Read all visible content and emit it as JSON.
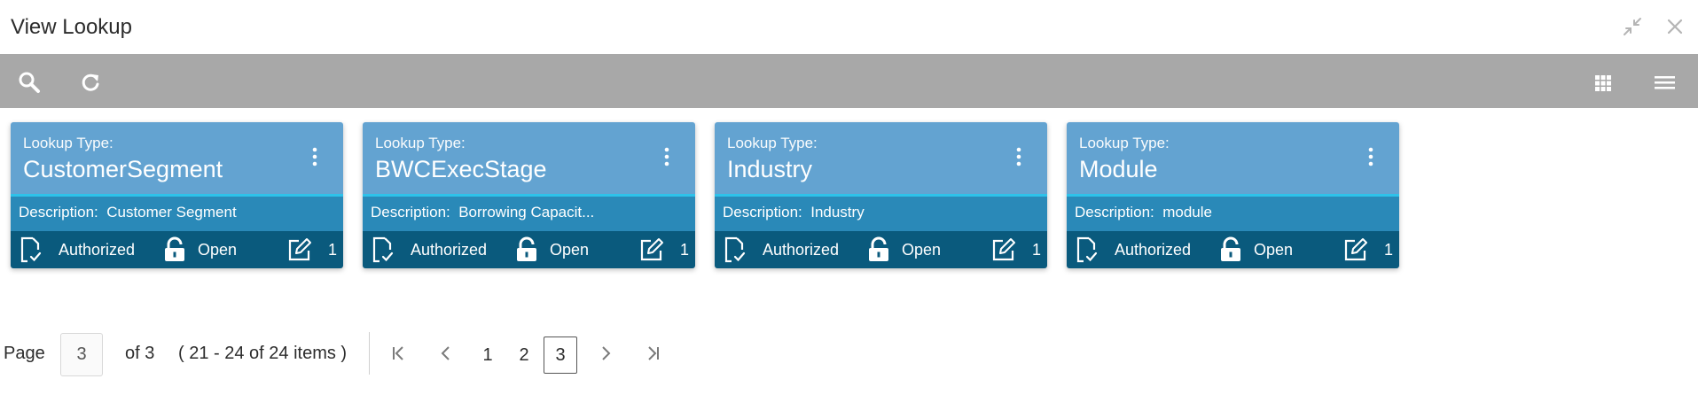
{
  "window": {
    "title": "View Lookup",
    "icons": [
      "minimize-icon",
      "close-icon"
    ]
  },
  "toolbar": {
    "left_icons": [
      "search-icon",
      "refresh-icon"
    ],
    "right_icons": [
      "grid-view-icon",
      "list-view-icon"
    ]
  },
  "colors": {
    "card_header": "#63a3d1",
    "card_accent": "#2ec2ea",
    "card_description": "#2a89b8",
    "card_footer": "#0a5a7d",
    "toolbar": "#a8a8a8"
  },
  "cards": [
    {
      "type_label": "Lookup Type:",
      "type_value": "CustomerSegment",
      "description_label": "Description:",
      "description_value": "Customer Segment",
      "status": "Authorized",
      "lock_state": "Open",
      "version": "1"
    },
    {
      "type_label": "Lookup Type:",
      "type_value": "BWCExecStage",
      "description_label": "Description:",
      "description_value": "Borrowing Capacit...",
      "status": "Authorized",
      "lock_state": "Open",
      "version": "1"
    },
    {
      "type_label": "Lookup Type:",
      "type_value": "Industry",
      "description_label": "Description:",
      "description_value": "Industry",
      "status": "Authorized",
      "lock_state": "Open",
      "version": "1"
    },
    {
      "type_label": "Lookup Type:",
      "type_value": "Module",
      "description_label": "Description:",
      "description_value": "module",
      "status": "Authorized",
      "lock_state": "Open",
      "version": "1"
    }
  ],
  "pagination": {
    "page_label": "Page",
    "current_page": "3",
    "of_label": "of 3",
    "range_text": "( 21 - 24 of 24 items )",
    "pages": [
      "1",
      "2",
      "3"
    ],
    "active_page": "3"
  }
}
